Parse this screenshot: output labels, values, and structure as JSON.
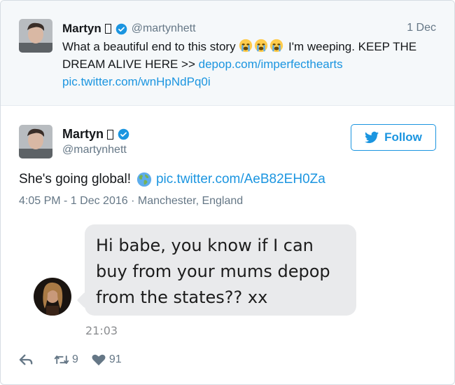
{
  "parent_tweet": {
    "name": "Martyn",
    "handle": "@martynhett",
    "date": "1 Dec",
    "text_before_emoji": "What a beautiful end to this story ",
    "text_after_emoji": " I'm weeping. KEEP THE DREAM ALIVE HERE >> ",
    "link_depop": "depop.com/imperfecthearts",
    "link_pic": "pic.twitter.com/wnHpNdPq0i"
  },
  "main_tweet": {
    "name": "Martyn",
    "handle": "@martynhett",
    "follow_label": "Follow",
    "text": "She's going global!",
    "link_pic": "pic.twitter.com/AeB82EH0Za",
    "meta": "4:05 PM - 1 Dec 2016 · Manchester, England"
  },
  "dm": {
    "message": "Hi babe, you know if I can buy from your mums depop from the states?? xx",
    "time": "21:03"
  },
  "actions": {
    "retweet_count": "9",
    "like_count": "91"
  },
  "colors": {
    "link": "#1b95e0",
    "muted": "#657786",
    "parent_bg": "#f5f8fa",
    "bubble": "#e9eaec"
  },
  "icons": [
    "verified-icon",
    "crying-emoji",
    "globe-emoji",
    "twitter-bird-icon",
    "reply-icon",
    "retweet-icon",
    "heart-icon"
  ]
}
